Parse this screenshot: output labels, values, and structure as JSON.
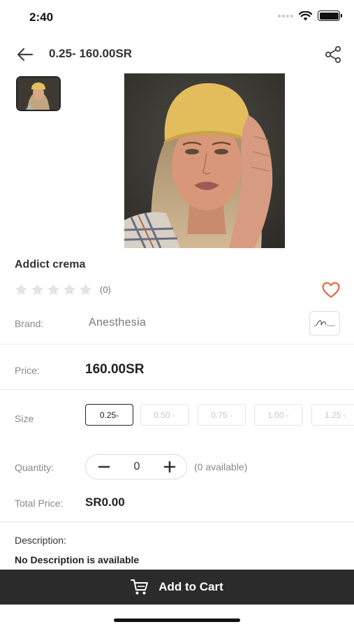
{
  "status_bar": {
    "time": "2:40"
  },
  "header": {
    "title": "0.25- 160.00SR"
  },
  "product": {
    "name": "Addict crema",
    "rating_count": "(0)"
  },
  "brand": {
    "label": "Brand:",
    "name": "Anesthesia"
  },
  "price": {
    "label": "Price:",
    "value": "160.00SR"
  },
  "size": {
    "label": "Size",
    "options": [
      "0.25-",
      "0.50 -",
      "0.75 -",
      "1.00 -",
      "1.25 -"
    ],
    "selected": "0.25-"
  },
  "quantity": {
    "label": "Quantity:",
    "value": "0",
    "minus": "−",
    "plus": "+",
    "available": "(0 available)"
  },
  "total": {
    "label": "Total Price:",
    "value": "SR0.00"
  },
  "description": {
    "label": "Description:",
    "text": "No Description is available"
  },
  "cart": {
    "label": "Add to Cart"
  },
  "icons": {
    "back": "arrow-left-icon",
    "share": "share-icon",
    "favorite": "heart-icon",
    "cart": "cart-icon",
    "star": "star-icon"
  },
  "colors": {
    "heart": "#e2603b",
    "star_empty": "#e3e3e3",
    "cart_bar": "#2b2b2b"
  }
}
